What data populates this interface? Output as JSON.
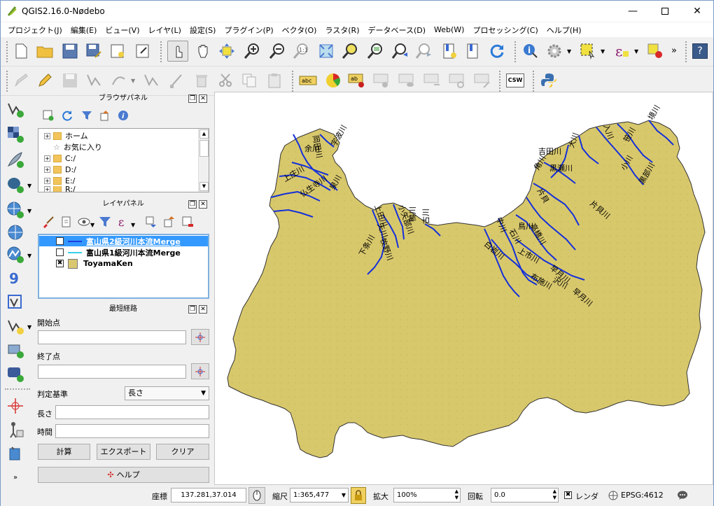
{
  "window": {
    "title": "QGIS2.16.0-Nødebo"
  },
  "menu": [
    "プロジェクト(J)",
    "編集(E)",
    "ビュー(V)",
    "レイヤ(L)",
    "設定(S)",
    "プラグイン(P)",
    "ベクタ(O)",
    "ラスタ(R)",
    "データベース(D)",
    "Web(W)",
    "プロセッシング(C)",
    "ヘルプ(H)"
  ],
  "toolbar": {
    "csw_label": "CSW",
    "overflow": "»",
    "help": "?"
  },
  "browser_panel": {
    "title": "ブラウザパネル",
    "items": [
      "ホーム",
      "お気に入り",
      "C:/",
      "D:/",
      "E:/",
      "R:/"
    ]
  },
  "layer_panel": {
    "title": "レイヤパネル",
    "layers": [
      {
        "name": "富山県2級河川本流Merge",
        "checked": true,
        "color": "#1f3ee0",
        "selected": true
      },
      {
        "name": "富山県1級河川本流Merge",
        "checked": false,
        "color": "#39d0e8",
        "selected": false
      },
      {
        "name": "ToyamaKen",
        "checked": true,
        "color": "#d9c870",
        "selected": false
      }
    ]
  },
  "shortest_path": {
    "title": "最短経路",
    "start_label": "開始点",
    "start_value": "",
    "end_label": "終了点",
    "end_value": "",
    "criterion_label": "判定基準",
    "criterion_value": "長さ",
    "length_label": "長さ",
    "length_value": "",
    "time_label": "時間",
    "time_value": "",
    "calc_button": "計算",
    "export_button": "エクスポート",
    "clear_button": "クリア",
    "help_button": "ヘルプ"
  },
  "map": {
    "fill_color": "#d8c86c",
    "river_color": "#1430d8",
    "river_labels": [
      "岡田川",
      "余川",
      "上庄川",
      "仏生寺川",
      "宇波川",
      "泉川",
      "上田川",
      "矢川",
      "牧野川",
      "下条川",
      "小矢部川",
      "鴨川",
      "古川",
      "吉田川",
      "角川",
      "黒瀬川",
      "片貝川",
      "早月川",
      "高橋川",
      "上市川",
      "白岩川",
      "中川",
      "鳥川",
      "大川",
      "入川",
      "笹川",
      "境川",
      "小川",
      "黒部川",
      "布施川",
      "片貝",
      "早月川",
      "沢川",
      "石川"
    ]
  },
  "status": {
    "coord_label": "座標",
    "coord_value": "137.281,37.014",
    "scale_label": "縮尺",
    "scale_value": "1:365,477",
    "magnifier_label": "拡大",
    "magnifier_value": "100%",
    "rotation_label": "回転",
    "rotation_value": "0.0",
    "render_label": "レンダ",
    "render_checked": true,
    "crs_value": "EPSG:4612"
  }
}
